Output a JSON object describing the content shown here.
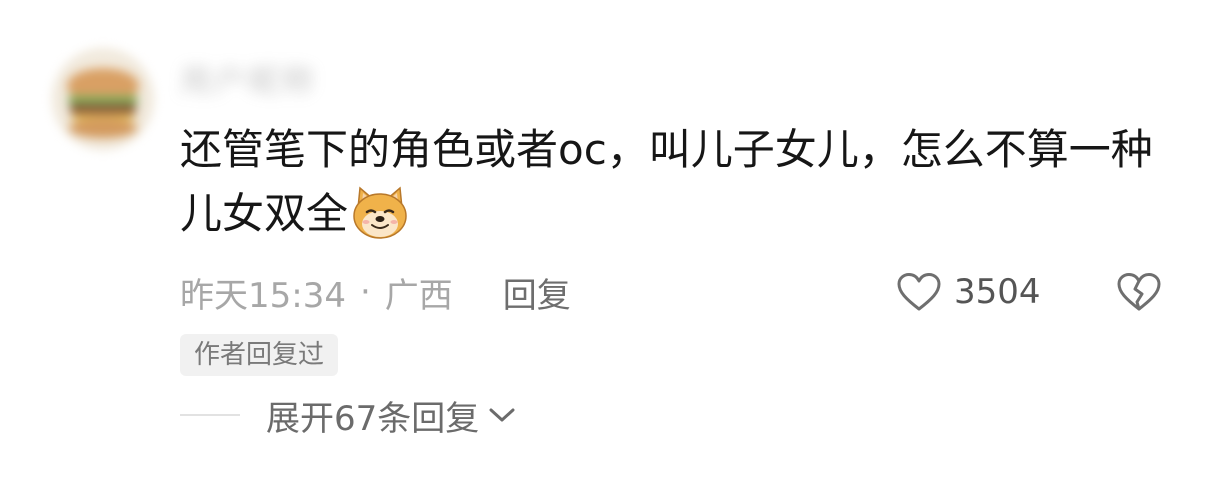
{
  "comment": {
    "username": "用户昵称",
    "text": "还管笔下的角色或者oc，叫儿子女儿，怎么不算一种儿女双全",
    "emoji_icon": "doge-icon",
    "timestamp": "昨天15:34",
    "separator": "·",
    "location": "广西",
    "reply_label": "回复",
    "like_count": "3504",
    "author_badge": "作者回复过",
    "expand_label": "展开67条回复"
  },
  "colors": {
    "text_primary": "#161616",
    "text_meta": "#a7a7a7",
    "text_secondary": "#6e6e6e",
    "badge_bg": "#f1f1f1",
    "emoji_fur": "#f0b24a"
  }
}
